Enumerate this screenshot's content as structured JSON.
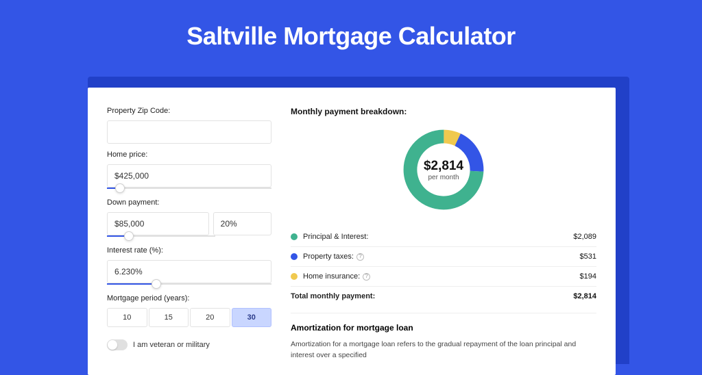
{
  "title": "Saltville Mortgage Calculator",
  "form": {
    "zip_label": "Property Zip Code:",
    "zip_value": "",
    "home_price_label": "Home price:",
    "home_price_value": "$425,000",
    "home_price_slider_pct": 8,
    "down_label": "Down payment:",
    "down_value": "$85,000",
    "down_pct_value": "20%",
    "down_slider_pct": 20,
    "rate_label": "Interest rate (%):",
    "rate_value": "6.230%",
    "rate_slider_pct": 30,
    "period_label": "Mortgage period (years):",
    "period_options": [
      "10",
      "15",
      "20",
      "30"
    ],
    "period_selected": "30",
    "veteran_label": "I am veteran or military",
    "veteran_on": false
  },
  "breakdown": {
    "heading": "Monthly payment breakdown:",
    "center_amount": "$2,814",
    "center_sub": "per month",
    "items": [
      {
        "label": "Principal & Interest:",
        "value": "$2,089",
        "color": "#3fb28f",
        "has_info": false
      },
      {
        "label": "Property taxes:",
        "value": "$531",
        "color": "#3355e6",
        "has_info": true
      },
      {
        "label": "Home insurance:",
        "value": "$194",
        "color": "#f0c94f",
        "has_info": true
      }
    ],
    "total_label": "Total monthly payment:",
    "total_value": "$2,814"
  },
  "chart_data": {
    "type": "pie",
    "title": "Monthly payment breakdown",
    "series": [
      {
        "name": "Principal & Interest",
        "value": 2089,
        "color": "#3fb28f"
      },
      {
        "name": "Property taxes",
        "value": 531,
        "color": "#3355e6"
      },
      {
        "name": "Home insurance",
        "value": 194,
        "color": "#f0c94f"
      }
    ],
    "total": 2814,
    "unit": "USD/month",
    "inner_radius_ratio": 0.64
  },
  "amortization": {
    "heading": "Amortization for mortgage loan",
    "text": "Amortization for a mortgage loan refers to the gradual repayment of the loan principal and interest over a specified"
  }
}
